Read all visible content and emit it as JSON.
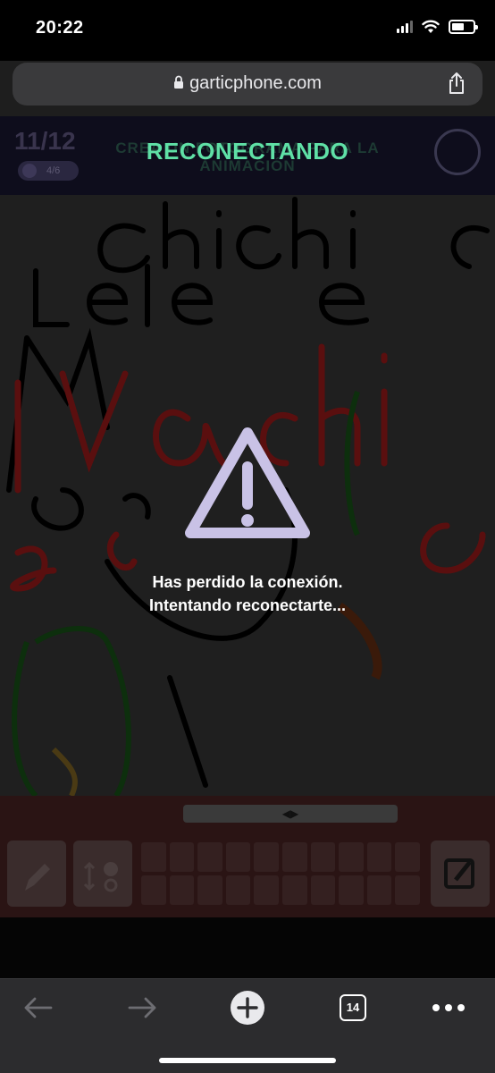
{
  "status_bar": {
    "time": "20:22"
  },
  "browser": {
    "url": "garticphone.com",
    "tab_count": "14"
  },
  "game": {
    "round": "11/12",
    "progress": "4/6",
    "task_title": "CREA UN FOTOGRAMA PARA LA ANIMACIÓN",
    "overlay_title": "RECONECTANDO"
  },
  "overlay": {
    "line1": "Has perdido la conexión.",
    "line2": "Intentando reconectarte..."
  },
  "colors": {
    "accent": "#5fe0a6",
    "warning": "#c9c2e6",
    "dim_background": "#232323"
  },
  "icons": [
    "lock-icon",
    "share-icon",
    "warning-icon",
    "pencil-icon",
    "brush-size-icon",
    "edit-icon",
    "back-icon",
    "forward-icon",
    "new-tab-icon",
    "more-icon"
  ]
}
